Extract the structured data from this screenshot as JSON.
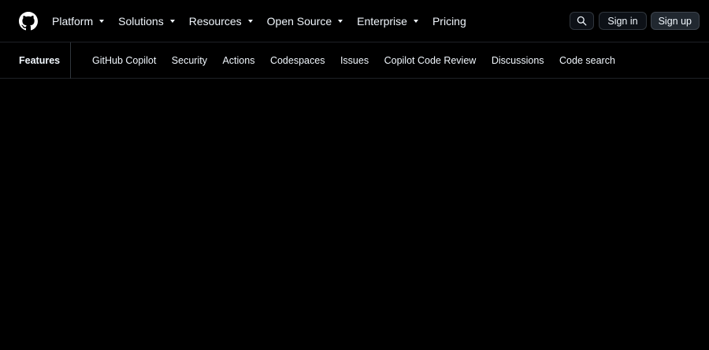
{
  "header": {
    "nav": [
      {
        "label": "Platform",
        "dropdown": true
      },
      {
        "label": "Solutions",
        "dropdown": true
      },
      {
        "label": "Resources",
        "dropdown": true
      },
      {
        "label": "Open Source",
        "dropdown": true
      },
      {
        "label": "Enterprise",
        "dropdown": true
      },
      {
        "label": "Pricing",
        "dropdown": false
      }
    ],
    "search_icon": "search-icon",
    "sign_in": "Sign in",
    "sign_up": "Sign up",
    "logo_icon": "github-logo-icon"
  },
  "subnav": {
    "title": "Features",
    "links": [
      "GitHub Copilot",
      "Security",
      "Actions",
      "Codespaces",
      "Issues",
      "Copilot Code Review",
      "Discussions",
      "Code search"
    ]
  },
  "colors": {
    "background": "#000000",
    "text": "#f0f6fc",
    "border": "#30363d"
  }
}
